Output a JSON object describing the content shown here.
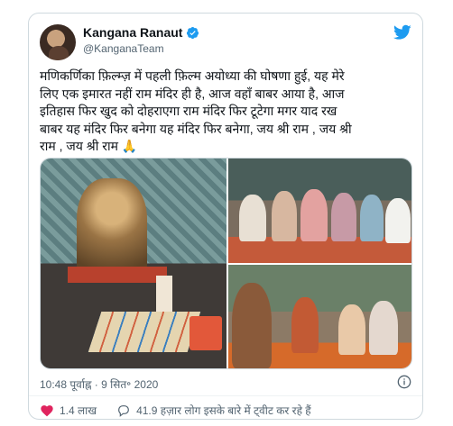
{
  "author": {
    "name": "Kangana Ranaut",
    "handle": "@KanganaTeam",
    "verified": true
  },
  "tweet": {
    "lines": [
      "मणिकर्णिका फ़िल्म्ज़ में पहली फ़िल्म अयोध्या की घोषणा हुई, यह मेरे",
      "लिए एक इमारत नहीं राम मंदिर ही है, आज वहाँ बाबर आया है, आज",
      "इतिहास फिर खुद को दोहराएगा राम मंदिर फिर टूटेगा मगर याद रख",
      "बाबर यह मंदिर फिर बनेगा यह मंदिर फिर बनेगा, जय श्री राम , जय श्री",
      "राम , जय श्री राम 🙏"
    ]
  },
  "media": {
    "photos": [
      {
        "icon": "idol-photo"
      },
      {
        "icon": "group-photo"
      },
      {
        "icon": "puja-photo"
      }
    ]
  },
  "timestamp": "10:48 पूर्वाह्न · 9 सित॰ 2020",
  "actions": {
    "likes": "1.4 लाख",
    "discussion": "41.9 हज़ार लोग इसके बारे में ट्वीट कर रहे हैं"
  },
  "colors": {
    "twitter_blue": "#1d9bf0",
    "like_red": "#e0245e",
    "secondary_text": "#536471",
    "border": "#cfd9de"
  }
}
